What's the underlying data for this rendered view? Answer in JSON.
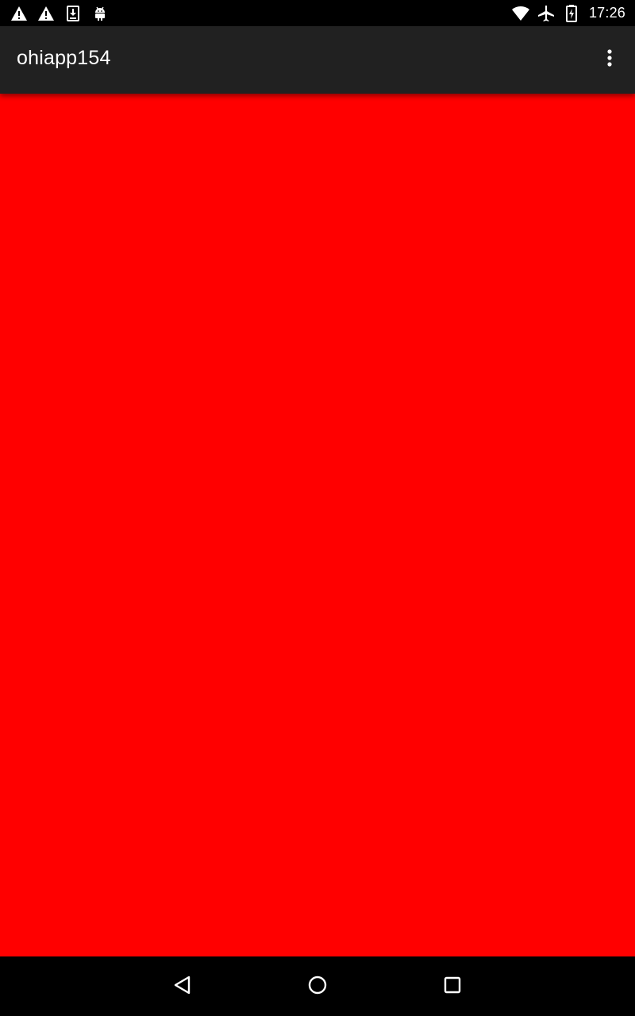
{
  "status_bar": {
    "time": "17:26",
    "left_icons": [
      "warning-icon",
      "warning-icon",
      "download-icon",
      "android-icon"
    ],
    "right_icons": [
      "wifi-icon",
      "airplane-mode-icon",
      "battery-charging-icon"
    ]
  },
  "app_bar": {
    "title": "ohiapp154",
    "overflow_icon": "more-vert-icon"
  },
  "content": {
    "background_color": "#ff0000"
  },
  "nav_bar": {
    "buttons": [
      "back-icon",
      "home-icon",
      "recents-icon"
    ]
  },
  "colors": {
    "app_bar": "#212121",
    "status_bar": "#000000",
    "nav_bar": "#000000",
    "content": "#ff0000"
  }
}
